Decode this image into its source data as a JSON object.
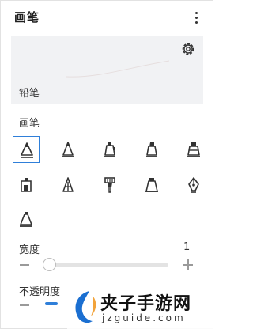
{
  "header": {
    "title": "画笔",
    "more_icon": "more-vertical-icon"
  },
  "preview": {
    "settings_icon": "gear-icon",
    "label": "铅笔"
  },
  "brushes": {
    "section_label": "画笔",
    "selected_index": 0,
    "items": [
      {
        "icon": "pencil-brush-icon"
      },
      {
        "icon": "pen-brush-icon"
      },
      {
        "icon": "marker-brush-icon"
      },
      {
        "icon": "highlighter-brush-icon"
      },
      {
        "icon": "broad-marker-brush-icon"
      },
      {
        "icon": "crayon-brush-icon"
      },
      {
        "icon": "fineliner-brush-icon"
      },
      {
        "icon": "paintbrush-icon"
      },
      {
        "icon": "wide-brush-icon"
      },
      {
        "icon": "fountain-pen-icon"
      },
      {
        "icon": "cone-brush-icon"
      }
    ]
  },
  "width": {
    "label": "宽度",
    "value": "1",
    "level": 0.0
  },
  "opacity": {
    "label": "不透明度"
  },
  "watermark": {
    "title": "夹子手游网",
    "url": "jzguide.com"
  },
  "colors": {
    "accent": "#2f7fd9",
    "preview_bg": "#f1f2f4"
  }
}
